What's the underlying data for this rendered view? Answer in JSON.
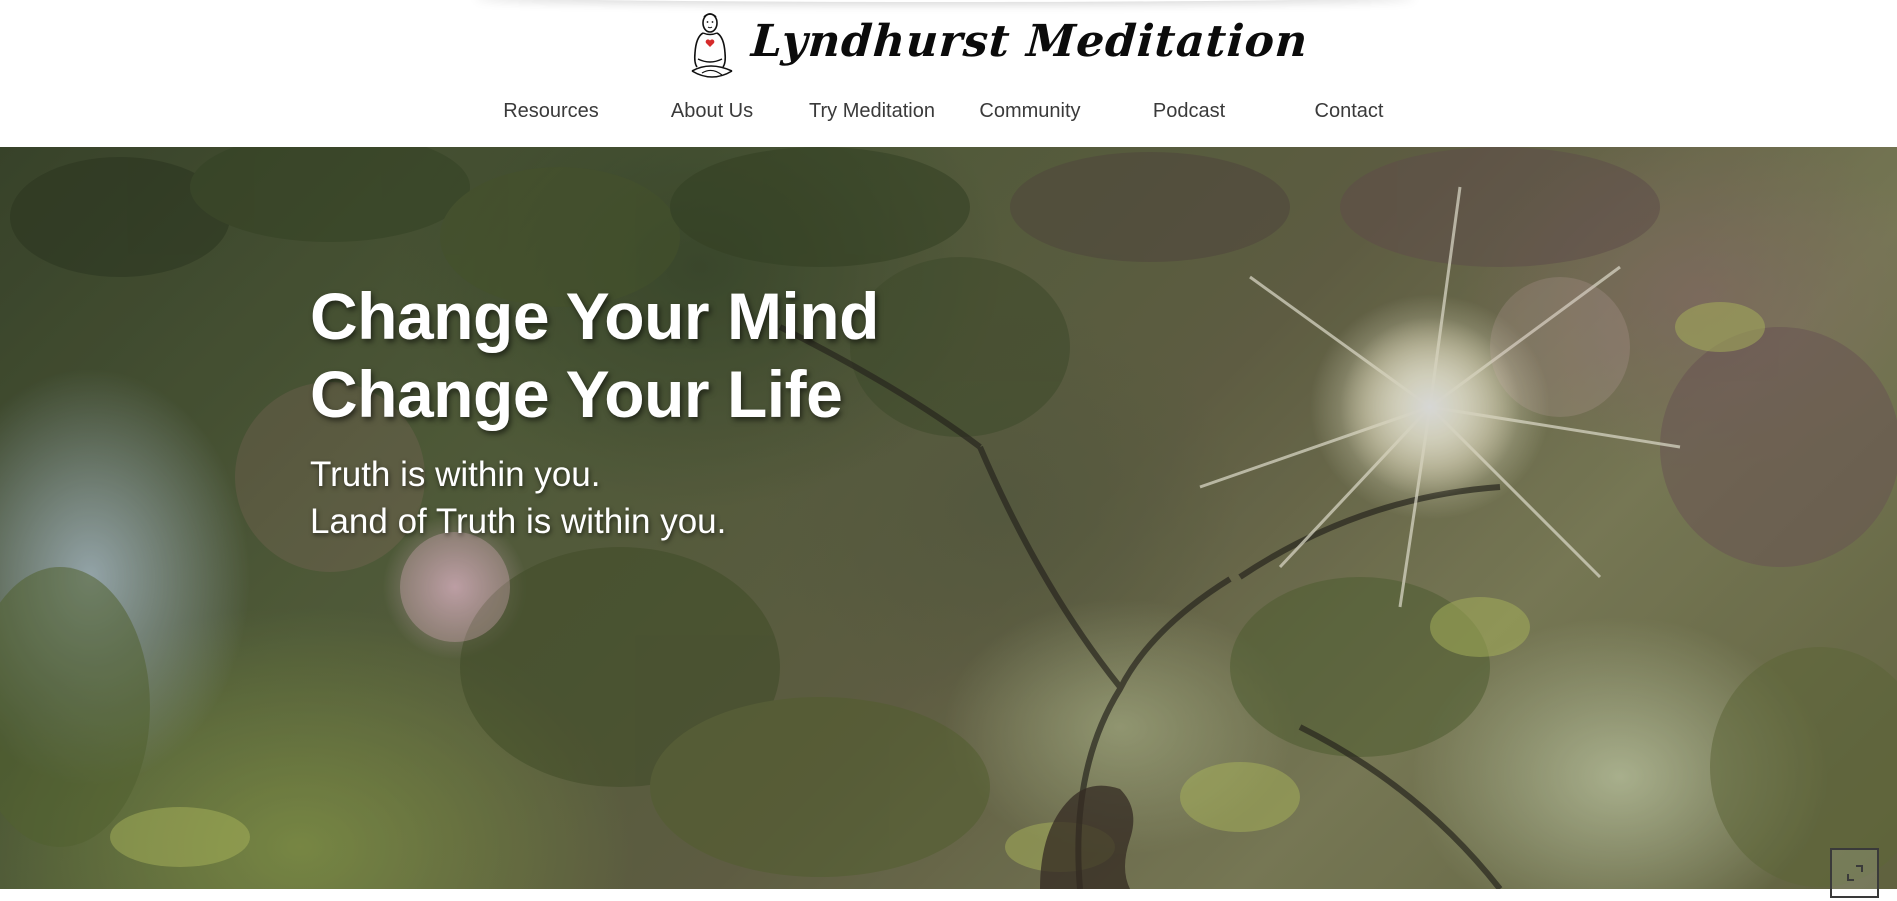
{
  "site": {
    "logo_text": "Lyndhurst Meditation",
    "logo_icon": "meditating-figure-icon"
  },
  "nav": {
    "items": [
      {
        "label": "Resources"
      },
      {
        "label": "About Us"
      },
      {
        "label": "Try Meditation"
      },
      {
        "label": "Community"
      },
      {
        "label": "Podcast"
      },
      {
        "label": "Contact"
      }
    ]
  },
  "hero": {
    "title_line1": "Change Your Mind",
    "title_line2": "Change Your Life",
    "subtitle_line1": "Truth is within you.",
    "subtitle_line2": "Land of Truth is within you.",
    "background_description_icon": "sunlit-tree-canopy-image"
  },
  "corner_widget": {
    "icon": "expand-icon"
  },
  "colors": {
    "nav_text": "#3a3a3a",
    "logo_text": "#0b0b0b",
    "hero_text": "#ffffff",
    "heart": "#d62b2b"
  }
}
